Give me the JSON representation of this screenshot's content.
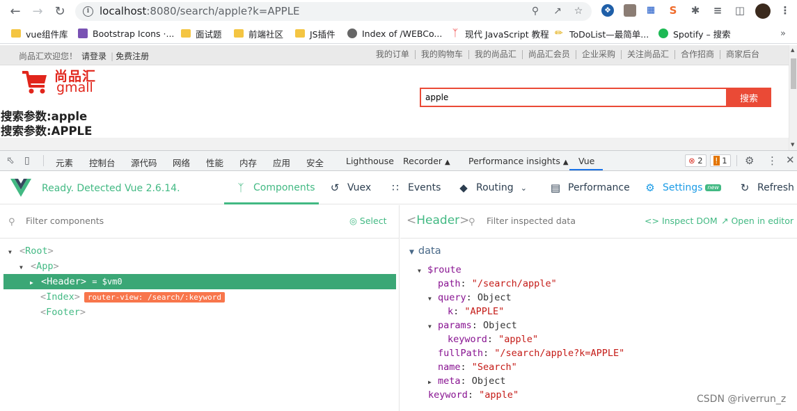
{
  "browser": {
    "url_host": "localhost",
    "url_rest": ":8080/search/apple?k=APPLE",
    "bookmarks": [
      {
        "label": "vue组件库",
        "icon": "folder-icon"
      },
      {
        "label": "Bootstrap Icons ·...",
        "icon": "bootstrap-icon"
      },
      {
        "label": "面试题",
        "icon": "folder-icon"
      },
      {
        "label": "前端社区",
        "icon": "folder-icon"
      },
      {
        "label": "JS插件",
        "icon": "folder-icon"
      },
      {
        "label": "Index of /WEBCo...",
        "icon": "globe-icon"
      },
      {
        "label": "现代 JavaScript 教程",
        "icon": "dancer-icon"
      },
      {
        "label": "ToDoList—最简单...",
        "icon": "pencil-icon"
      },
      {
        "label": "Spotify – 搜索",
        "icon": "spotify-icon"
      }
    ]
  },
  "page": {
    "welcome": "尚品汇欢迎您！",
    "login": "请登录",
    "register": "免费注册",
    "topnav": [
      "我的订单",
      "我的购物车",
      "我的尚品汇",
      "尚品汇会员",
      "企业采购",
      "关注尚品汇",
      "合作招商",
      "商家后台"
    ],
    "logo_cn": "尚品汇",
    "logo_en": "gmall",
    "search_value": "apple",
    "search_button": "搜索",
    "param1": "搜索参数:apple",
    "param2": "搜索参数:APPLE"
  },
  "devtools": {
    "tabs": [
      "元素",
      "控制台",
      "源代码",
      "网络",
      "性能",
      "内存",
      "应用",
      "安全",
      "Lighthouse",
      "Recorder",
      "Performance insights",
      "Vue"
    ],
    "errors": "2",
    "warnings": "1",
    "vue": {
      "ready": "Ready. Detected Vue 2.6.14.",
      "nav": [
        {
          "label": "Components",
          "icon": "components-icon"
        },
        {
          "label": "Vuex",
          "icon": "history-icon"
        },
        {
          "label": "Events",
          "icon": "events-icon"
        },
        {
          "label": "Routing",
          "icon": "routing-icon"
        },
        {
          "label": "Performance",
          "icon": "performance-icon"
        },
        {
          "label": "Settings",
          "icon": "settings-icon"
        },
        {
          "label": "Refresh",
          "icon": "refresh-icon"
        }
      ],
      "new_badge": "new",
      "filter_components_placeholder": "Filter components",
      "select_label": "Select",
      "tree": {
        "root": "Root",
        "app": "App",
        "header": "Header",
        "header_vm": "= $vm0",
        "index": "Index",
        "router_view_tag": "router-view: /search/:keyword",
        "footer": "Footer"
      },
      "inspected": {
        "component": "Header",
        "filter_placeholder": "Filter inspected data",
        "inspect_dom": "Inspect DOM",
        "open_editor": "Open in editor",
        "section": "data",
        "route_key": "$route",
        "path_key": "path",
        "path_val": "\"/search/apple\"",
        "query_key": "query",
        "query_type": "Object",
        "k_key": "k",
        "k_val": "\"APPLE\"",
        "params_key": "params",
        "params_type": "Object",
        "keyword_key": "keyword",
        "keyword_val": "\"apple\"",
        "fullpath_key": "fullPath",
        "fullpath_val": "\"/search/apple?k=APPLE\"",
        "name_key": "name",
        "name_val": "\"Search\"",
        "meta_key": "meta",
        "meta_type": "Object",
        "keyword2_key": "keyword",
        "keyword2_val": "\"apple\""
      }
    }
  },
  "watermark": "CSDN @riverrun_z",
  "colors": {
    "vue_green": "#42b983",
    "selected_row": "#3ba776",
    "router_tag": "#f8764c",
    "brand_red": "#e1251b"
  }
}
